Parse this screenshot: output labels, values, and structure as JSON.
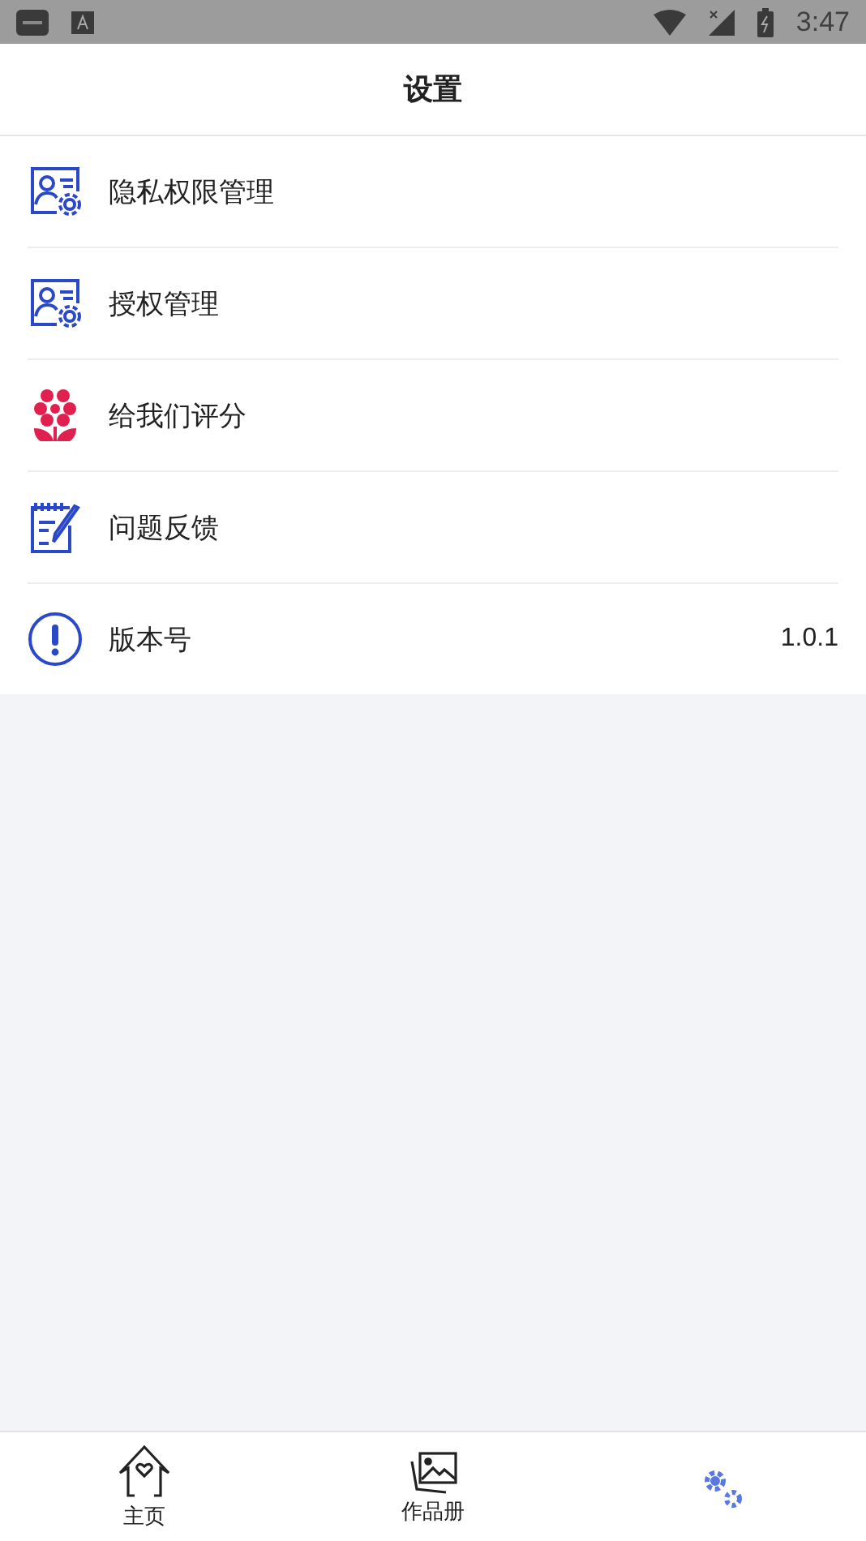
{
  "status_bar": {
    "time": "3:47"
  },
  "header": {
    "title": "设置"
  },
  "items": [
    {
      "kind": "privacy",
      "label": "隐私权限管理"
    },
    {
      "kind": "auth",
      "label": "授权管理"
    },
    {
      "kind": "rate",
      "label": "给我们评分"
    },
    {
      "kind": "feedback",
      "label": "问题反馈"
    },
    {
      "kind": "version",
      "label": "版本号",
      "value": "1.0.1"
    }
  ],
  "tabs": [
    {
      "kind": "home",
      "label": "主页",
      "selected": false
    },
    {
      "kind": "album",
      "label": "作品册",
      "selected": false
    },
    {
      "kind": "settings",
      "selected": true
    }
  ]
}
